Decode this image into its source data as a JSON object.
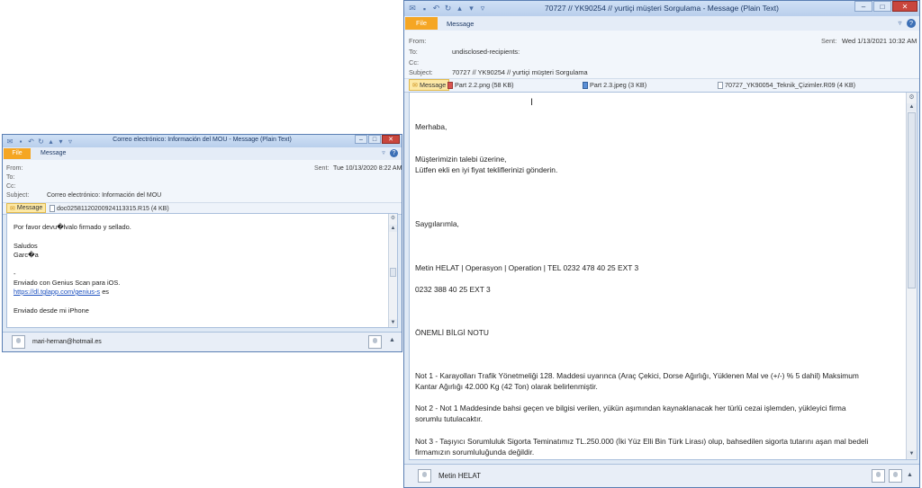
{
  "left_window": {
    "title": "Correo electrónico: Información del MOU  -  Message (Plain Text)",
    "ribbon": {
      "file_tab": "File",
      "message_tab": "Message"
    },
    "header": {
      "from_label": "From:",
      "to_label": "To:",
      "cc_label": "Cc:",
      "subject_label": "Subject:",
      "sent_label": "Sent:",
      "sent_value": "Tue 10/13/2020 8:22 AM",
      "subject_value": "Correo electrónico: Información del MOU"
    },
    "attachments": [
      {
        "label": "Message"
      },
      {
        "label": "doc02581120200924113315.R15 (4 KB)"
      }
    ],
    "body": {
      "line1": "Por favor devu�lvalo firmado y sellado.",
      "line2": "Saludos",
      "line3": "Garc�a",
      "line4": "-",
      "line5": "Enviado con Genius Scan para iOS.",
      "link": "https://dl.tglapp.com/genius-s",
      "link_suffix": " es",
      "line7": "Enviado desde mi iPhone"
    },
    "people": {
      "name": "mari-hernan@hotmail.es"
    }
  },
  "right_window": {
    "title": "70727 // YK90254 // yurtiçi müşteri Sorgulama  -  Message (Plain Text)",
    "ribbon": {
      "file_tab": "File",
      "message_tab": "Message"
    },
    "header": {
      "from_label": "From:",
      "to_label": "To:",
      "cc_label": "Cc:",
      "subject_label": "Subject:",
      "to_value": "undisclosed-recipients:",
      "subject_value": "70727 // YK90254 // yurtiçi müşteri Sorgulama",
      "sent_label": "Sent:",
      "sent_value": "Wed 1/13/2021 10:32 AM"
    },
    "attachments": [
      {
        "label": "Message"
      },
      {
        "label": "Part 2.2.png (58 KB)"
      },
      {
        "label": "Part 2.3.jpeg (3 KB)"
      },
      {
        "label": "70727_YK90054_Teknik_Çizimler.R09 (4 KB)"
      }
    ],
    "body": {
      "greeting": "Merhaba,",
      "p1_l1": "Müşterimizin talebi üzerine,",
      "p1_l2": "Lütfen ekli en iyi fiyat tekliflerinizi gönderin.",
      "regards": "Saygılarımla,",
      "sig1": "Metin HELAT | Operasyon | Operation | TEL 0232 478 40 25 EXT  3",
      "sig2": "0232 388 40 25  EXT 3",
      "notice_title": "ÖNEMLİ BİLGİ NOTU",
      "note1_l1": "Not 1 - Karayolları Trafik Yönetmeliği 128. Maddesi uyarınca (Araç Çekici, Dorse Ağırlığı, Yüklenen Mal ve (+/-) % 5 dahil) Maksimum",
      "note1_l2": "Kantar Ağırlığı  42.000 Kg (42 Ton) olarak belirlenmiştir.",
      "note2_l1": "Not 2 - Not 1 Maddesinde bahsi geçen ve bilgisi verilen, yükün aşımından kaynaklanacak her türlü cezai işlemden, yükleyici firma",
      "note2_l2": "sorumlu tutulacaktır.",
      "note3_l1": "Not 3 - Taşıyıcı Sorumluluk Sigorta Teminatımız TL.250.000 (İki Yüz Elli Bin Türk Lirası) olup, bahsedilen sigorta tutarını aşan mal bedeli",
      "note3_l2": "firmamızın sorumluluğunda değildir."
    },
    "people": {
      "name": "Metin HELAT"
    }
  },
  "colors": {
    "file_tab": "#f5a623",
    "link": "#1a4fbf",
    "close_button": "#c9463d",
    "title_bar": "#c5d9f1"
  }
}
